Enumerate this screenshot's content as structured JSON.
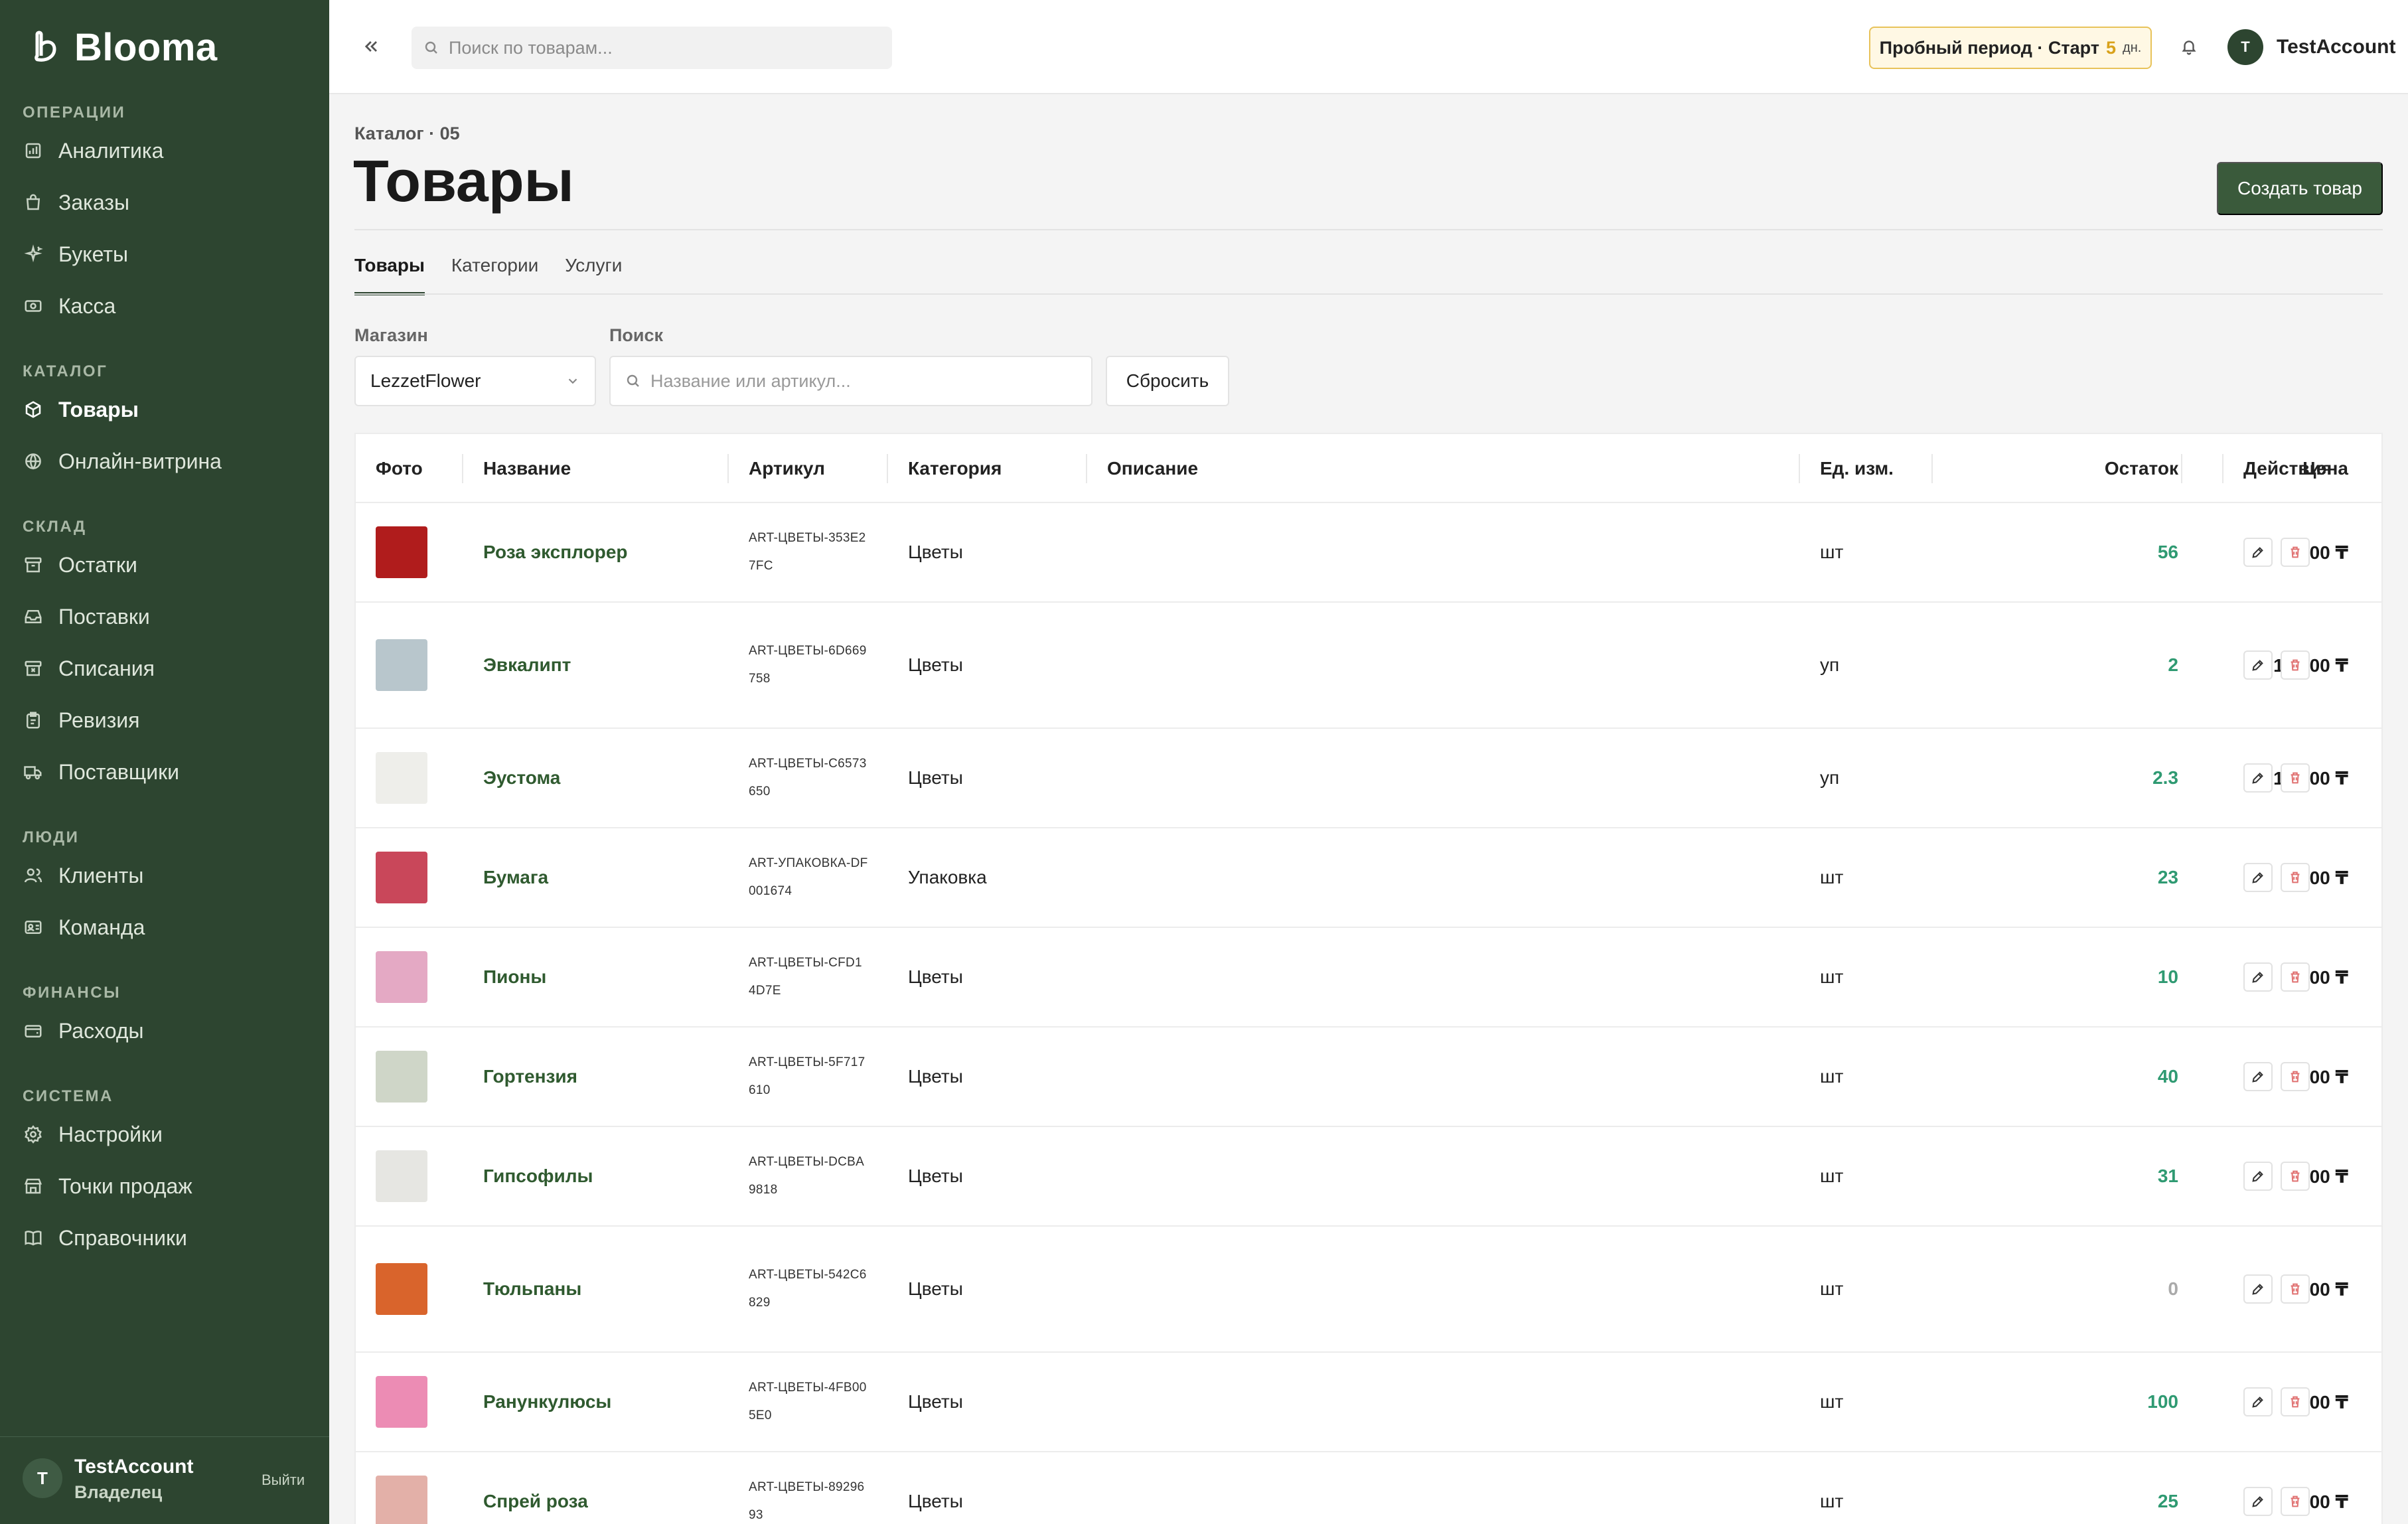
{
  "app": {
    "brand": "Blooma",
    "search_placeholder": "Поиск по товарам...",
    "trial": {
      "label": "Пробный период · Старт",
      "days": "5",
      "days_unit": "дн."
    },
    "user": {
      "initial": "T",
      "name": "TestAccount",
      "role": "Владелец",
      "logout": "Выйти"
    }
  },
  "sidebar": {
    "sections": [
      {
        "title": "ОПЕРАЦИИ",
        "items": [
          {
            "label": "Аналитика",
            "icon": "chart-icon"
          },
          {
            "label": "Заказы",
            "icon": "bag-icon"
          },
          {
            "label": "Букеты",
            "icon": "sparkle-icon"
          },
          {
            "label": "Касса",
            "icon": "cash-icon"
          }
        ]
      },
      {
        "title": "КАТАЛОГ",
        "items": [
          {
            "label": "Товары",
            "icon": "cube-icon",
            "active": true
          },
          {
            "label": "Онлайн-витрина",
            "icon": "globe-icon"
          }
        ]
      },
      {
        "title": "СКЛАД",
        "items": [
          {
            "label": "Остатки",
            "icon": "archive-icon"
          },
          {
            "label": "Поставки",
            "icon": "inbox-icon"
          },
          {
            "label": "Списания",
            "icon": "archive-x-icon"
          },
          {
            "label": "Ревизия",
            "icon": "clipboard-icon"
          },
          {
            "label": "Поставщики",
            "icon": "truck-icon"
          }
        ]
      },
      {
        "title": "ЛЮДИ",
        "items": [
          {
            "label": "Клиенты",
            "icon": "users-icon"
          },
          {
            "label": "Команда",
            "icon": "id-card-icon"
          }
        ]
      },
      {
        "title": "ФИНАНСЫ",
        "items": [
          {
            "label": "Расходы",
            "icon": "wallet-icon"
          }
        ]
      },
      {
        "title": "СИСТЕМА",
        "items": [
          {
            "label": "Настройки",
            "icon": "gear-icon"
          },
          {
            "label": "Точки продаж",
            "icon": "store-icon"
          },
          {
            "label": "Справочники",
            "icon": "book-icon"
          }
        ]
      }
    ]
  },
  "page": {
    "breadcrumb": "Каталог · 05",
    "title": "Товары",
    "create_button": "Создать товар",
    "tabs": [
      "Товары",
      "Категории",
      "Услуги"
    ],
    "filters": {
      "store_label": "Магазин",
      "store_value": "LezzetFlower",
      "search_label": "Поиск",
      "search_placeholder": "Название или артикул...",
      "reset": "Сбросить"
    }
  },
  "table": {
    "columns": [
      "Фото",
      "Название",
      "Артикул",
      "Категория",
      "Описание",
      "Ед. изм.",
      "Остаток",
      "Цена",
      "Действия"
    ],
    "rows": [
      {
        "name": "Роза эксплорер",
        "sku": "ART-ЦВЕТЫ-353E27FC",
        "category": "Цветы",
        "description": "",
        "unit": "шт",
        "stock": "56",
        "price": "1 200 ₸",
        "photo_color": "#b01c1c"
      },
      {
        "name": "Эвкалипт",
        "sku": "ART-ЦВЕТЫ-6D669758",
        "category": "Цветы",
        "description": "",
        "unit": "уп",
        "stock": "2",
        "price": "10 000 ₸",
        "photo_color": "#b8c6cc"
      },
      {
        "name": "Эустома",
        "sku": "ART-ЦВЕТЫ-C6573650",
        "category": "Цветы",
        "description": "",
        "unit": "уп",
        "stock": "2.3",
        "price": "15 000 ₸",
        "photo_color": "#eeeeea"
      },
      {
        "name": "Бумага",
        "sku": "ART-УПАКОВКА-DF001674",
        "category": "Упаковка",
        "description": "",
        "unit": "шт",
        "stock": "23",
        "price": "1 500 ₸",
        "photo_color": "#c9475a"
      },
      {
        "name": "Пионы",
        "sku": "ART-ЦВЕТЫ-CFD14D7E",
        "category": "Цветы",
        "description": "",
        "unit": "шт",
        "stock": "10",
        "price": "2 500 ₸",
        "photo_color": "#e4a9c4"
      },
      {
        "name": "Гортензия",
        "sku": "ART-ЦВЕТЫ-5F717610",
        "category": "Цветы",
        "description": "",
        "unit": "шт",
        "stock": "40",
        "price": "800 ₸",
        "photo_color": "#cfd6c8"
      },
      {
        "name": "Гипсофилы",
        "sku": "ART-ЦВЕТЫ-DCBA9818",
        "category": "Цветы",
        "description": "",
        "unit": "шт",
        "stock": "31",
        "price": "2 200 ₸",
        "photo_color": "#e6e6e2"
      },
      {
        "name": "Тюльпаны",
        "sku": "ART-ЦВЕТЫ-542C6829",
        "category": "Цветы",
        "description": "",
        "unit": "шт",
        "stock": "0",
        "price": "700 ₸",
        "photo_color": "#d9642c"
      },
      {
        "name": "Ранункулюсы",
        "sku": "ART-ЦВЕТЫ-4FB005E0",
        "category": "Цветы",
        "description": "",
        "unit": "шт",
        "stock": "100",
        "price": "2 600 ₸",
        "photo_color": "#ec8cb4"
      },
      {
        "name": "Спрей роза",
        "sku": "ART-ЦВЕТЫ-8929693",
        "category": "Цветы",
        "description": "",
        "unit": "шт",
        "stock": "25",
        "price": "1 400 ₸",
        "photo_color": "#e3b0a8"
      }
    ]
  }
}
